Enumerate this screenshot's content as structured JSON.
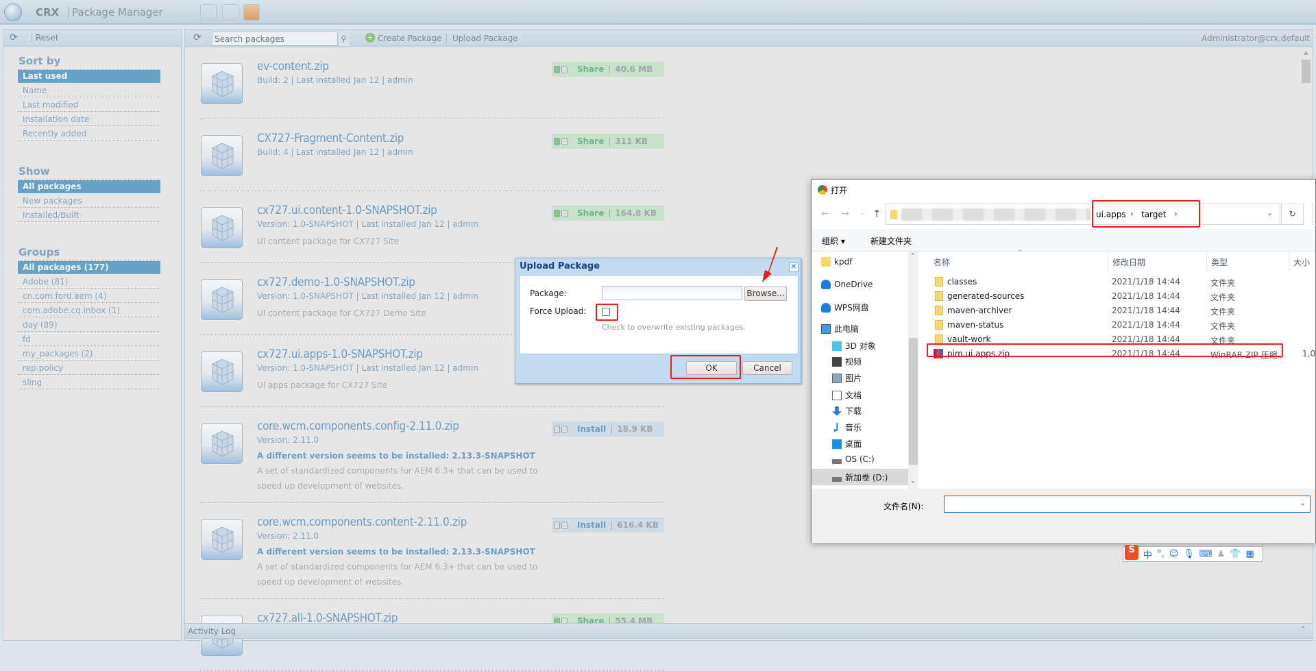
{
  "header": {
    "brand": "CRX",
    "title": "Package Manager",
    "tool_icons": [
      "tools-icon",
      "package-icon",
      "share-icon"
    ]
  },
  "sidebar": {
    "reset": "Reset",
    "sort_title": "Sort by",
    "sort": [
      "Last used",
      "Name",
      "Last modified",
      "Installation date",
      "Recently added"
    ],
    "sort_selected": 0,
    "show_title": "Show",
    "show": [
      "All packages",
      "New packages",
      "Installed/Built"
    ],
    "show_selected": 0,
    "groups_title": "Groups",
    "groups": [
      "All packages (177)",
      "Adobe (81)",
      "cn.com.ford.aem (4)",
      "com.adobe.cq.inbox (1)",
      "day (89)",
      "fd",
      "my_packages (2)",
      "rep:policy",
      "sling"
    ],
    "groups_selected": 0
  },
  "toolbar": {
    "search_placeholder": "Search packages",
    "create": "Create Package",
    "upload": "Upload Package",
    "user": "Administrator@crx.default"
  },
  "packages": [
    {
      "name": "ev-content.zip",
      "meta": "Build: 2 | Last installed Jan 12 | admin",
      "action": "Share",
      "size": "40.6 MB"
    },
    {
      "name": "CX727-Fragment-Content.zip",
      "meta": "Build: 4 | Last installed Jan 12 | admin",
      "action": "Share",
      "size": "311 KB"
    },
    {
      "name": "cx727.ui.content-1.0-SNAPSHOT.zip",
      "meta": "Version: 1.0-SNAPSHOT | Last installed Jan 12 | admin",
      "desc": "UI content package for CX727 Site",
      "action": "Share",
      "size": "164.8 KB"
    },
    {
      "name": "cx727.demo-1.0-SNAPSHOT.zip",
      "meta": "Version: 1.0-SNAPSHOT | Last installed Jan 12 | admin",
      "desc": "UI content package for CX727 Demo Site"
    },
    {
      "name": "cx727.ui.apps-1.0-SNAPSHOT.zip",
      "meta": "Version: 1.0-SNAPSHOT | Last installed Jan 12 | admin",
      "desc": "UI apps package for CX727 Site"
    },
    {
      "name": "core.wcm.components.config-2.11.0.zip",
      "meta": "Version: 2.11.0",
      "warn": "A different version seems to be installed: 2.13.3-SNAPSHOT",
      "desc": "A set of standardized components for AEM 6.3+ that can be used to speed up development of websites.",
      "action": "Install",
      "size": "18.9 KB"
    },
    {
      "name": "core.wcm.components.content-2.11.0.zip",
      "meta": "Version: 2.11.0",
      "warn": "A different version seems to be installed: 2.13.3-SNAPSHOT",
      "desc": "A set of standardized components for AEM 6.3+ that can be used to speed up development of websites.",
      "action": "Install",
      "size": "616.4 KB"
    },
    {
      "name": "cx727.all-1.0-SNAPSHOT.zip",
      "action": "Share",
      "size": "55.4 MB"
    }
  ],
  "activity_log": "Activity Log",
  "upload_dialog": {
    "title": "Upload Package",
    "package_label": "Package:",
    "package_value": "",
    "browse": "Browse...",
    "force_label": "Force Upload:",
    "force_checked": false,
    "force_hint": "Check to overwrite existing packages.",
    "ok": "OK",
    "cancel": "Cancel"
  },
  "file_dialog": {
    "title": "打开",
    "path": [
      "ui.apps",
      "target"
    ],
    "organize": "组织 ▾",
    "new_folder": "新建文件夹",
    "nav": [
      {
        "label": "kpdf",
        "icon": "folder-icon"
      },
      {
        "label": "OneDrive",
        "icon": "cloud-icon"
      },
      {
        "label": "WPS网盘",
        "icon": "cloud-icon"
      },
      {
        "label": "此电脑",
        "icon": "computer-icon"
      },
      {
        "label": "3D 对象",
        "icon": "cube-icon"
      },
      {
        "label": "视频",
        "icon": "video-icon"
      },
      {
        "label": "图片",
        "icon": "picture-icon"
      },
      {
        "label": "文档",
        "icon": "document-icon"
      },
      {
        "label": "下载",
        "icon": "download-icon"
      },
      {
        "label": "音乐",
        "icon": "music-icon"
      },
      {
        "label": "桌面",
        "icon": "desktop-icon"
      },
      {
        "label": "OS (C:)",
        "icon": "drive-icon"
      },
      {
        "label": "新加卷 (D:)",
        "icon": "drive-icon"
      }
    ],
    "nav_selected": 12,
    "columns": [
      "名称",
      "修改日期",
      "类型",
      "大小"
    ],
    "files": [
      {
        "name": "classes",
        "date": "2021/1/18 14:44",
        "type": "文件夹",
        "size": ""
      },
      {
        "name": "generated-sources",
        "date": "2021/1/18 14:44",
        "type": "文件夹",
        "size": ""
      },
      {
        "name": "maven-archiver",
        "date": "2021/1/18 14:44",
        "type": "文件夹",
        "size": ""
      },
      {
        "name": "maven-status",
        "date": "2021/1/18 14:44",
        "type": "文件夹",
        "size": ""
      },
      {
        "name": "vault-work",
        "date": "2021/1/18 14:44",
        "type": "文件夹",
        "size": ""
      },
      {
        "name": "pim.ui.apps.zip",
        "date": "2021/1/18 14:44",
        "type": "WinRAR ZIP 压缩...",
        "size": "1,0"
      }
    ],
    "filename_label": "文件名(N):",
    "filename_value": ""
  },
  "ime": {
    "mode": "中",
    "punct": "°,"
  },
  "colors": {
    "selected": "#65a2c5",
    "share_badge": "#c9e2cb",
    "install_badge": "#cfdbe5",
    "annotation": "#f21b1b",
    "accent_blue": "#0078d7"
  }
}
